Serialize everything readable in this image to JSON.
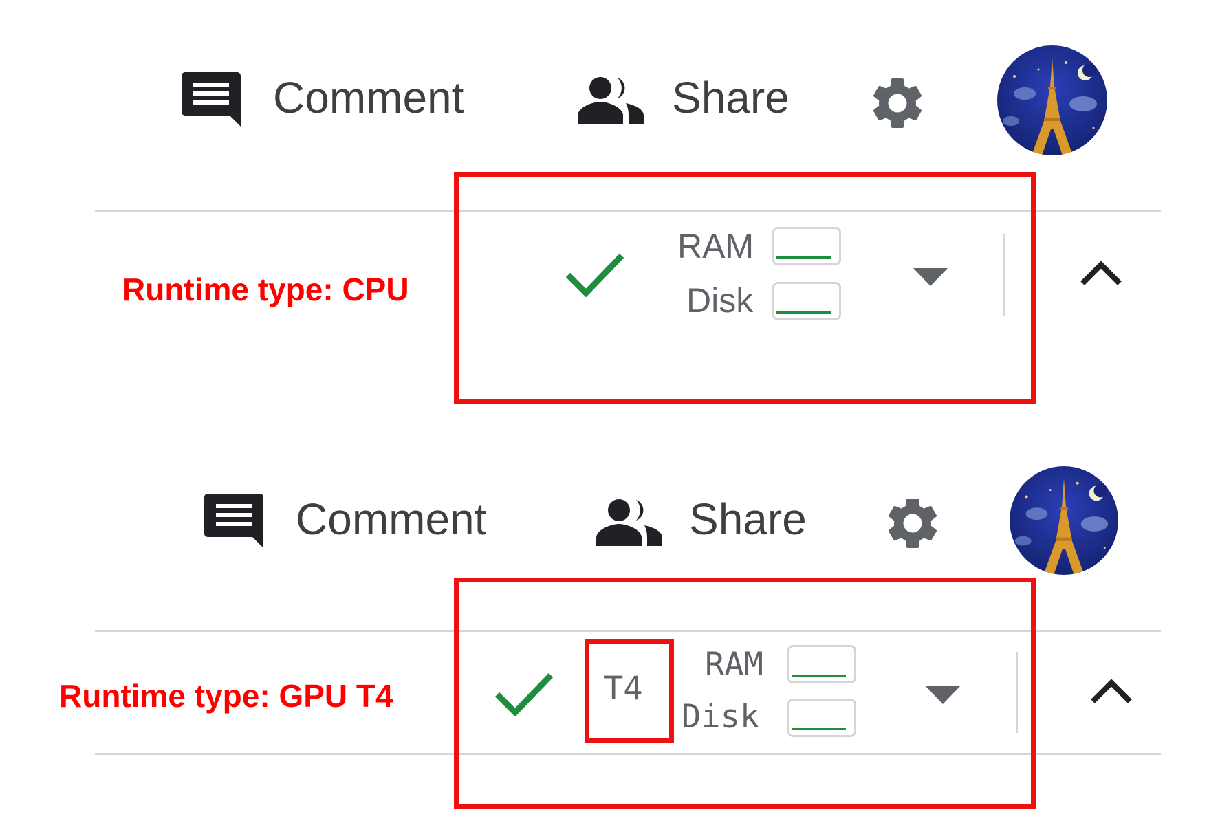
{
  "panels": [
    {
      "toolbar": {
        "comment_label": "Comment",
        "share_label": "Share"
      },
      "runtime_label": "Runtime type: CPU",
      "resources": {
        "gpu_label": "",
        "ram_label": "RAM",
        "disk_label": "Disk",
        "ram_usage": 0.05,
        "disk_usage": 0.05
      }
    },
    {
      "toolbar": {
        "comment_label": "Comment",
        "share_label": "Share"
      },
      "runtime_label": "Runtime type: GPU T4",
      "resources": {
        "gpu_label": "T4",
        "ram_label": "RAM",
        "disk_label": "Disk",
        "ram_usage": 0.05,
        "disk_usage": 0.05
      }
    }
  ],
  "icons": {
    "comment": "comment-icon",
    "share": "people-icon",
    "settings": "gear-icon",
    "avatar": "avatar-eiffel-night",
    "connected": "checkmark-icon",
    "dropdown": "dropdown-triangle-icon",
    "collapse": "chevron-up-icon"
  },
  "colors": {
    "annotation_red": "#ff0000",
    "check_green": "#1e8e3e",
    "usage_bar_green": "#1e8e3e",
    "icon_dark": "#202124"
  }
}
